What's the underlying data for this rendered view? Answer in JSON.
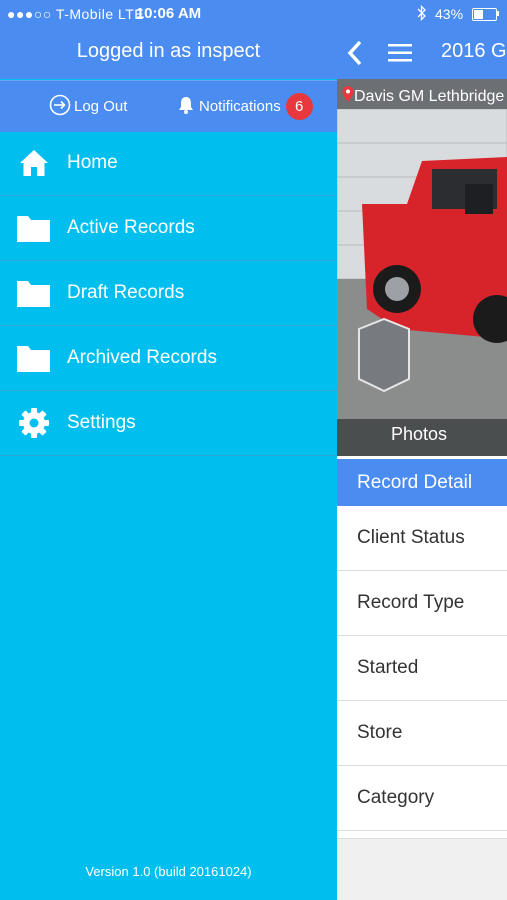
{
  "status_bar": {
    "carrier": "●●●○○ T-Mobile   LTE",
    "time": "10:06 AM",
    "battery": "43%"
  },
  "drawer": {
    "logged_in": "Logged in as inspect",
    "logout_label": "Log Out",
    "notifications_label": "Notifications",
    "notifications_count": "6",
    "nav": [
      {
        "label": "Home",
        "icon": "home-icon"
      },
      {
        "label": "Active Records",
        "icon": "folder-icon"
      },
      {
        "label": "Draft Records",
        "icon": "folder-icon"
      },
      {
        "label": "Archived Records",
        "icon": "folder-icon"
      },
      {
        "label": "Settings",
        "icon": "gear-icon"
      }
    ],
    "version": "Version 1.0 (build 20161024)"
  },
  "main": {
    "title": "2016 G",
    "location": "Davis GM Lethbridge",
    "photos_label": "Photos",
    "section_header": "Record Detail",
    "rows": [
      "Client Status",
      "Record Type",
      "Started",
      "Store",
      "Category"
    ]
  },
  "colors": {
    "header_blue": "#4A8CF0",
    "drawer_cyan": "#00BFEE",
    "badge_red": "#E8383D"
  }
}
